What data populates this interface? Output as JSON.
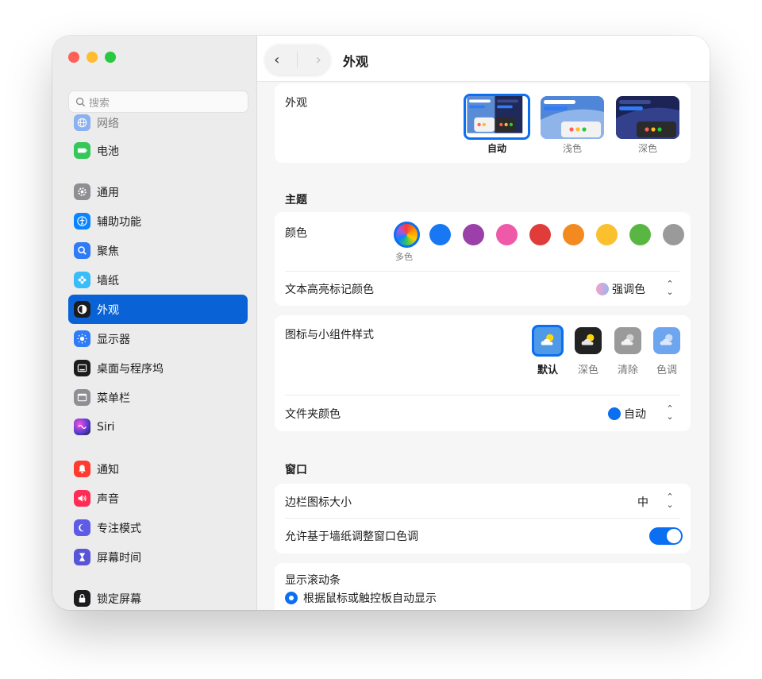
{
  "window": {
    "title": "外观"
  },
  "sidebar": {
    "search_placeholder": "搜索",
    "items": [
      {
        "label": "网络",
        "icon": "globe-icon",
        "color": "#3b82f6"
      },
      {
        "label": "电池",
        "icon": "battery-icon",
        "color": "#34c759"
      },
      {
        "label": "通用",
        "icon": "gear-icon",
        "color": "#8e8e93"
      },
      {
        "label": "辅助功能",
        "icon": "accessibility-icon",
        "color": "#0a84ff"
      },
      {
        "label": "聚焦",
        "icon": "spotlight-search-icon",
        "color": "#2f7cf6"
      },
      {
        "label": "墙纸",
        "icon": "flower-icon",
        "color": "#38bdf8"
      },
      {
        "label": "外观",
        "icon": "appearance-icon",
        "color": "#1c1c1e"
      },
      {
        "label": "显示器",
        "icon": "sun-icon",
        "color": "#2f7cf6"
      },
      {
        "label": "桌面与程序坞",
        "icon": "dock-icon",
        "color": "#1c1c1e"
      },
      {
        "label": "菜单栏",
        "icon": "menubar-icon",
        "color": "#8e8e93"
      },
      {
        "label": "Siri",
        "icon": "siri-icon",
        "color": "#7c3aed"
      },
      {
        "label": "通知",
        "icon": "bell-icon",
        "color": "#ff3b30"
      },
      {
        "label": "声音",
        "icon": "speaker-icon",
        "color": "#ff2d55"
      },
      {
        "label": "专注模式",
        "icon": "moon-icon",
        "color": "#5e5ce6"
      },
      {
        "label": "屏幕时间",
        "icon": "hourglass-icon",
        "color": "#5856d6"
      },
      {
        "label": "锁定屏幕",
        "icon": "lock-icon",
        "color": "#1c1c1e"
      }
    ]
  },
  "appearance": {
    "label": "外观",
    "options": [
      {
        "label": "自动",
        "selected": true
      },
      {
        "label": "浅色",
        "selected": false
      },
      {
        "label": "深色",
        "selected": false
      }
    ]
  },
  "theme": {
    "heading": "主题",
    "color_label": "颜色",
    "colors": [
      {
        "name": "多色",
        "hex": "multicolor",
        "selected": true
      },
      {
        "name": "blue",
        "hex": "#1878f3"
      },
      {
        "name": "purple",
        "hex": "#9b3fa9"
      },
      {
        "name": "pink",
        "hex": "#ef5aa8"
      },
      {
        "name": "red",
        "hex": "#e03c3a"
      },
      {
        "name": "orange",
        "hex": "#f38a20"
      },
      {
        "name": "yellow",
        "hex": "#fbc02d"
      },
      {
        "name": "green",
        "hex": "#5ab643"
      },
      {
        "name": "graphite",
        "hex": "#9a9a9a"
      }
    ],
    "multicolor_caption": "多色",
    "highlight_label": "文本高亮标记颜色",
    "highlight_value": "强调色",
    "widget_style_label": "图标与小组件样式",
    "widget_styles": [
      "默认",
      "深色",
      "清除",
      "色调"
    ],
    "folder_color_label": "文件夹颜色",
    "folder_color_value": "自动"
  },
  "windows": {
    "heading": "窗口",
    "sidebar_icon_size_label": "边栏图标大小",
    "sidebar_icon_size_value": "中",
    "wallpaper_tint_label": "允许基于墙纸调整窗口色调",
    "wallpaper_tint_on": true,
    "scrollbars_label": "显示滚动条",
    "scrollbars_option": "根据鼠标或触控板自动显示"
  },
  "colors": {
    "accent": "#0a63d6",
    "toggle": "#0a6ff0"
  }
}
